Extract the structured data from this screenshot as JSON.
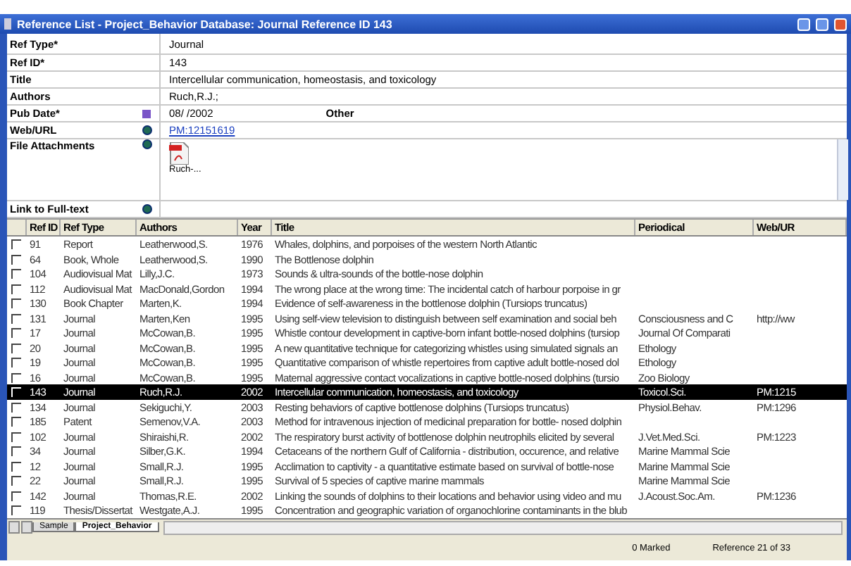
{
  "window": {
    "title": "Reference List - Project_Behavior Database: Journal Reference ID 143"
  },
  "form": {
    "fields": [
      {
        "label": "Ref Type*",
        "value": "Journal",
        "kind": "text"
      },
      {
        "label": "Ref ID*",
        "value": "143",
        "kind": "text"
      },
      {
        "label": "Title",
        "value": "Intercellular communication, homeostasis, and toxicology",
        "kind": "text"
      },
      {
        "label": "Authors",
        "value": "Ruch,R.J.;",
        "kind": "text"
      },
      {
        "label": "Pub Date*",
        "value": "08/  /2002",
        "extra": "Other",
        "kind": "date"
      },
      {
        "label": "Web/URL",
        "value": "PM:12151619",
        "kind": "link"
      },
      {
        "label": "File Attachments",
        "value": "Ruch-...",
        "kind": "files"
      },
      {
        "label": "Link to Full-text",
        "kind": "link"
      }
    ]
  },
  "table": {
    "columns": [
      "Ref ID",
      "Ref Type",
      "Authors",
      "Year",
      "Title",
      "Periodical",
      "Web/UR"
    ],
    "rows": [
      {
        "cells": [
          "91",
          "Report",
          "Leatherwood,S.",
          "1976",
          "Whales, dolphins, and porpoises of the western North Atlantic",
          "",
          ""
        ],
        "checked": false,
        "selected": false
      },
      {
        "cells": [
          "64",
          "Book, Whole",
          "Leatherwood,S.",
          "1990",
          "The Bottlenose dolphin",
          "",
          ""
        ],
        "checked": false,
        "selected": false
      },
      {
        "cells": [
          "104",
          "Audiovisual Mat",
          "Lilly,J.C.",
          "1973",
          "Sounds & ultra-sounds of the bottle-nose dolphin",
          "",
          ""
        ],
        "checked": false,
        "selected": false
      },
      {
        "cells": [
          "112",
          "Audiovisual Mat",
          "MacDonald,Gordon",
          "1994",
          "The wrong place at the wrong time: The incidental catch of harbour porpoise in gr",
          "",
          ""
        ],
        "checked": false,
        "selected": false
      },
      {
        "cells": [
          "130",
          "Book Chapter",
          "Marten,K.",
          "1994",
          "Evidence of self-awareness in the bottlenose dolphin (Tursiops truncatus)",
          "",
          ""
        ],
        "checked": false,
        "selected": false
      },
      {
        "cells": [
          "131",
          "Journal",
          "Marten,Ken",
          "1995",
          "Using self-view television to distinguish between self examination and social beh",
          "Consciousness and C",
          "http://ww"
        ],
        "checked": false,
        "selected": false
      },
      {
        "cells": [
          "17",
          "Journal",
          "McCowan,B.",
          "1995",
          "Whistle contour development in captive-born infant bottle-nosed dolphins (tursiop",
          "Journal Of Comparati",
          ""
        ],
        "checked": false,
        "selected": false
      },
      {
        "cells": [
          "20",
          "Journal",
          "McCowan,B.",
          "1995",
          "A new quantitative technique for categorizing whistles using simulated signals an",
          "Ethology",
          ""
        ],
        "checked": false,
        "selected": false
      },
      {
        "cells": [
          "19",
          "Journal",
          "McCowan,B.",
          "1995",
          "Quantitative comparison of whistle repertoires from captive adult bottle-nosed dol",
          "Ethology",
          ""
        ],
        "checked": false,
        "selected": false
      },
      {
        "cells": [
          "16",
          "Journal",
          "McCowan,B.",
          "1995",
          "Maternal aggressive contact vocalizations in captive bottle-nosed dolphins (tursio",
          "Zoo Biology",
          ""
        ],
        "checked": false,
        "selected": false
      },
      {
        "cells": [
          "143",
          "Journal",
          "Ruch,R.J.",
          "2002",
          "Intercellular communication, homeostasis, and toxicology",
          "Toxicol.Sci.",
          "PM:1215"
        ],
        "checked": false,
        "selected": true
      },
      {
        "cells": [
          "134",
          "Journal",
          "Sekiguchi,Y.",
          "2003",
          "Resting behaviors of captive bottlenose dolphins (Tursiops truncatus)",
          "Physiol.Behav.",
          "PM:1296"
        ],
        "checked": false,
        "selected": false
      },
      {
        "cells": [
          "185",
          "Patent",
          "Semenov,V.A.",
          "2003",
          "Method for intravenous injection of medicinal preparation for bottle- nosed dolphin",
          "",
          ""
        ],
        "checked": false,
        "selected": false
      },
      {
        "cells": [
          "102",
          "Journal",
          "Shiraishi,R.",
          "2002",
          "The respiratory burst activity of bottlenose dolphin neutrophils elicited by several",
          "J.Vet.Med.Sci.",
          "PM:1223"
        ],
        "checked": false,
        "selected": false
      },
      {
        "cells": [
          "34",
          "Journal",
          "Silber,G.K.",
          "1994",
          "Cetaceans of the northern Gulf of California - distribution, occurence, and relative",
          "Marine Mammal Scie",
          ""
        ],
        "checked": false,
        "selected": false
      },
      {
        "cells": [
          "12",
          "Journal",
          "Small,R.J.",
          "1995",
          "Acclimation to captivity - a quantitative estimate based on survival of bottle-nose",
          "Marine Mammal Scie",
          ""
        ],
        "checked": false,
        "selected": false
      },
      {
        "cells": [
          "22",
          "Journal",
          "Small,R.J.",
          "1995",
          "Survival of 5 species of captive marine mammals",
          "Marine Mammal Scie",
          ""
        ],
        "checked": false,
        "selected": false
      },
      {
        "cells": [
          "142",
          "Journal",
          "Thomas,R.E.",
          "2002",
          "Linking the sounds of dolphins to their locations and behavior using video and mu",
          "J.Acoust.Soc.Am.",
          "PM:1236"
        ],
        "checked": false,
        "selected": false
      },
      {
        "cells": [
          "119",
          "Thesis/Dissertat",
          "Westgate,A.J.",
          "1995",
          "Concentration and geographic variation of organochlorine contaminants in the blub",
          "",
          ""
        ],
        "checked": false,
        "selected": false
      }
    ]
  },
  "sheet_tabs": [
    {
      "label": "Sample",
      "selected": false
    },
    {
      "label": "Project_Behavior",
      "selected": true
    }
  ],
  "status_bar": {
    "marked": "0 Marked",
    "position": "Reference 21 of 33"
  }
}
